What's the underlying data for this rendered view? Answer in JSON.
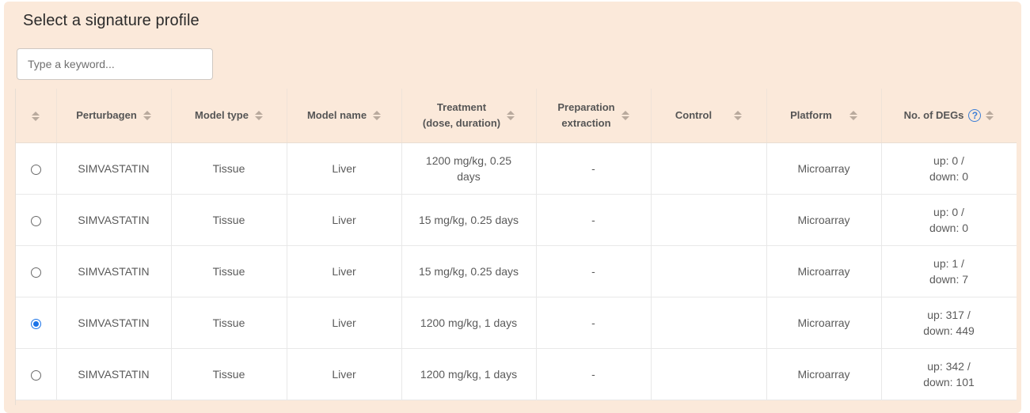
{
  "title": "Select a signature profile",
  "search": {
    "placeholder": "Type a keyword..."
  },
  "columns": [
    {
      "line1": "",
      "line2": ""
    },
    {
      "line1": "Perturbagen",
      "line2": ""
    },
    {
      "line1": "Model type",
      "line2": ""
    },
    {
      "line1": "Model name",
      "line2": ""
    },
    {
      "line1": "Treatment",
      "line2": "(dose, duration)"
    },
    {
      "line1": "Preparation",
      "line2": "extraction"
    },
    {
      "line1": "Control",
      "line2": ""
    },
    {
      "line1": "Platform",
      "line2": ""
    },
    {
      "line1": "No. of DEGs",
      "line2": ""
    }
  ],
  "help_icon": "?",
  "rows": [
    {
      "selected": false,
      "perturbagen": "SIMVASTATIN",
      "model_type": "Tissue",
      "model_name": "Liver",
      "treatment_a": "1200 mg/kg, 0.25",
      "treatment_b": "days",
      "preparation": "-",
      "control": "",
      "platform": "Microarray",
      "degs_up": "up: 0 /",
      "degs_down": "down: 0"
    },
    {
      "selected": false,
      "perturbagen": "SIMVASTATIN",
      "model_type": "Tissue",
      "model_name": "Liver",
      "treatment_a": "15 mg/kg, 0.25 days",
      "treatment_b": "",
      "preparation": "-",
      "control": "",
      "platform": "Microarray",
      "degs_up": "up: 0 /",
      "degs_down": "down: 0"
    },
    {
      "selected": false,
      "perturbagen": "SIMVASTATIN",
      "model_type": "Tissue",
      "model_name": "Liver",
      "treatment_a": "15 mg/kg, 0.25 days",
      "treatment_b": "",
      "preparation": "-",
      "control": "",
      "platform": "Microarray",
      "degs_up": "up: 1 /",
      "degs_down": "down: 7"
    },
    {
      "selected": true,
      "perturbagen": "SIMVASTATIN",
      "model_type": "Tissue",
      "model_name": "Liver",
      "treatment_a": "1200 mg/kg, 1 days",
      "treatment_b": "",
      "preparation": "-",
      "control": "",
      "platform": "Microarray",
      "degs_up": "up: 317 /",
      "degs_down": "down: 449"
    },
    {
      "selected": false,
      "perturbagen": "SIMVASTATIN",
      "model_type": "Tissue",
      "model_name": "Liver",
      "treatment_a": "1200 mg/kg, 1 days",
      "treatment_b": "",
      "preparation": "-",
      "control": "",
      "platform": "Microarray",
      "degs_up": "up: 342 /",
      "degs_down": "down: 101"
    }
  ],
  "colors": {
    "panel_bg": "#fbe9da",
    "radio_selected": "#1a73e8",
    "help_icon": "#3d7fd6"
  }
}
